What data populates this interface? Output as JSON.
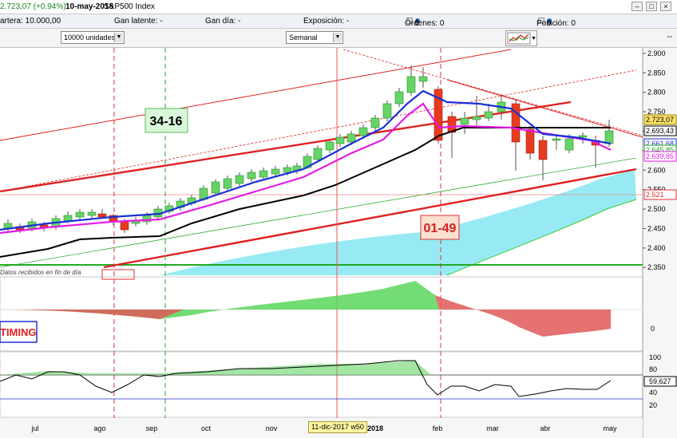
{
  "topbar": {
    "price_change": "2.723,07 (+0,94%)",
    "date": "10-may-2018",
    "instrument": "S&P500 Index"
  },
  "infobar": {
    "cartera": "artera: 10.000,00",
    "gan_latente": "Gan latente: -",
    "gan_dia": "Gan día: -",
    "exposicion": "Exposición: -",
    "ordenes": "Órdenes: 0",
    "ordenes_count2": "0",
    "posicion": "Posición: 0",
    "posicion_count2": "0"
  },
  "toolbar": {
    "units_select": "10000 unidades",
    "period_select": "Semanal"
  },
  "price_axis": {
    "ticks": [
      "2.900",
      "2.850",
      "2.800",
      "2.750",
      "2.700",
      "2.650",
      "2.600",
      "2.550",
      "2.500",
      "2.450",
      "2.400",
      "2.350"
    ],
    "last_price": "2.723,07",
    "tags": [
      {
        "text": "2.693,43",
        "color": "#000000"
      },
      {
        "text": "2.661,68",
        "color": "#1a2fd6"
      },
      {
        "text": "2.645,85",
        "color": "#19a319"
      },
      {
        "text": "2.639,85",
        "color": "#e51ae5"
      },
      {
        "text": "2.521",
        "color": "#e03030"
      }
    ]
  },
  "osc_axis": {
    "ticks": [
      "0"
    ]
  },
  "rsi_axis": {
    "ticks": [
      "100",
      "80",
      "59,627",
      "40",
      "20"
    ]
  },
  "time_axis": {
    "labels": [
      "jul",
      "ago",
      "sep",
      "oct",
      "nov",
      "2018",
      "feb",
      "mar",
      "abr",
      "may"
    ],
    "current_date": "11-dic-2017 w50"
  },
  "annotations": {
    "label_3416": "34-16",
    "label_0149": "01-49",
    "timing_label": "TIMING",
    "data_note": "Datos recibidos en fin de día"
  },
  "colors": {
    "bull_candle": "#66d466",
    "bear_candle": "#e83a1e",
    "kumo": "#8ce8f2",
    "blue_line": "#1a2fd6",
    "magenta_line": "#e51ae5",
    "channel_red": "#e02020",
    "osc_pos": "#5cd65c",
    "osc_neg": "#e05858"
  }
}
